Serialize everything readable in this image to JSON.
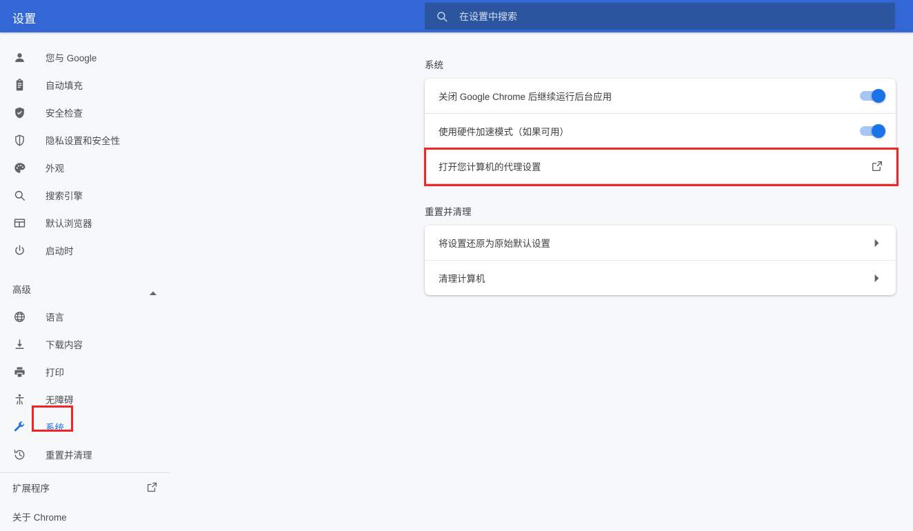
{
  "topbar": {
    "title": "设置",
    "search_icon": "search-icon",
    "search_placeholder": "在设置中搜索",
    "background_color": "#3367d6",
    "search_background_color": "#2b569f"
  },
  "sidebar": {
    "items": [
      {
        "label": "您与 Google",
        "icon": "person-icon",
        "selected": false
      },
      {
        "label": "自动填充",
        "icon": "clipboard-icon",
        "selected": false
      },
      {
        "label": "安全检查",
        "icon": "shield-check-icon",
        "selected": false
      },
      {
        "label": "隐私设置和安全性",
        "icon": "shield-icon",
        "selected": false
      },
      {
        "label": "外观",
        "icon": "palette-icon",
        "selected": false
      },
      {
        "label": "搜索引擎",
        "icon": "search-icon",
        "selected": false
      },
      {
        "label": "默认浏览器",
        "icon": "browser-window-icon",
        "selected": false
      },
      {
        "label": "启动时",
        "icon": "power-icon",
        "selected": false
      }
    ],
    "advanced": {
      "label": "高级",
      "expanded": true,
      "chevron_icon": "chevron-up-icon",
      "items": [
        {
          "label": "语言",
          "icon": "globe-icon",
          "selected": false
        },
        {
          "label": "下载内容",
          "icon": "download-icon",
          "selected": false
        },
        {
          "label": "打印",
          "icon": "printer-icon",
          "selected": false
        },
        {
          "label": "无障碍",
          "icon": "accessibility-icon",
          "selected": false
        },
        {
          "label": "系统",
          "icon": "wrench-icon",
          "selected": true
        },
        {
          "label": "重置并清理",
          "icon": "history-restore-icon",
          "selected": false
        }
      ]
    },
    "footer": [
      {
        "label": "扩展程序",
        "external_icon": "external-link-icon"
      },
      {
        "label": "关于 Chrome",
        "external_icon": null
      }
    ],
    "selected_color": "#1a73e8"
  },
  "main": {
    "sections": [
      {
        "title": "系统",
        "rows": [
          {
            "label": "关闭 Google Chrome 后继续运行后台应用",
            "control": "toggle",
            "toggle_on": true
          },
          {
            "label": "使用硬件加速模式（如果可用）",
            "control": "toggle",
            "toggle_on": true
          },
          {
            "label": "打开您计算机的代理设置",
            "control": "external-link-icon",
            "highlighted": true
          }
        ]
      },
      {
        "title": "重置并清理",
        "rows": [
          {
            "label": "将设置还原为原始默认设置",
            "control": "chevron-right-icon"
          },
          {
            "label": "清理计算机",
            "control": "chevron-right-icon"
          }
        ]
      }
    ]
  },
  "annotations": {
    "highlight_color": "#f12525",
    "targets": [
      "系统",
      "打开您计算机的代理设置"
    ]
  }
}
